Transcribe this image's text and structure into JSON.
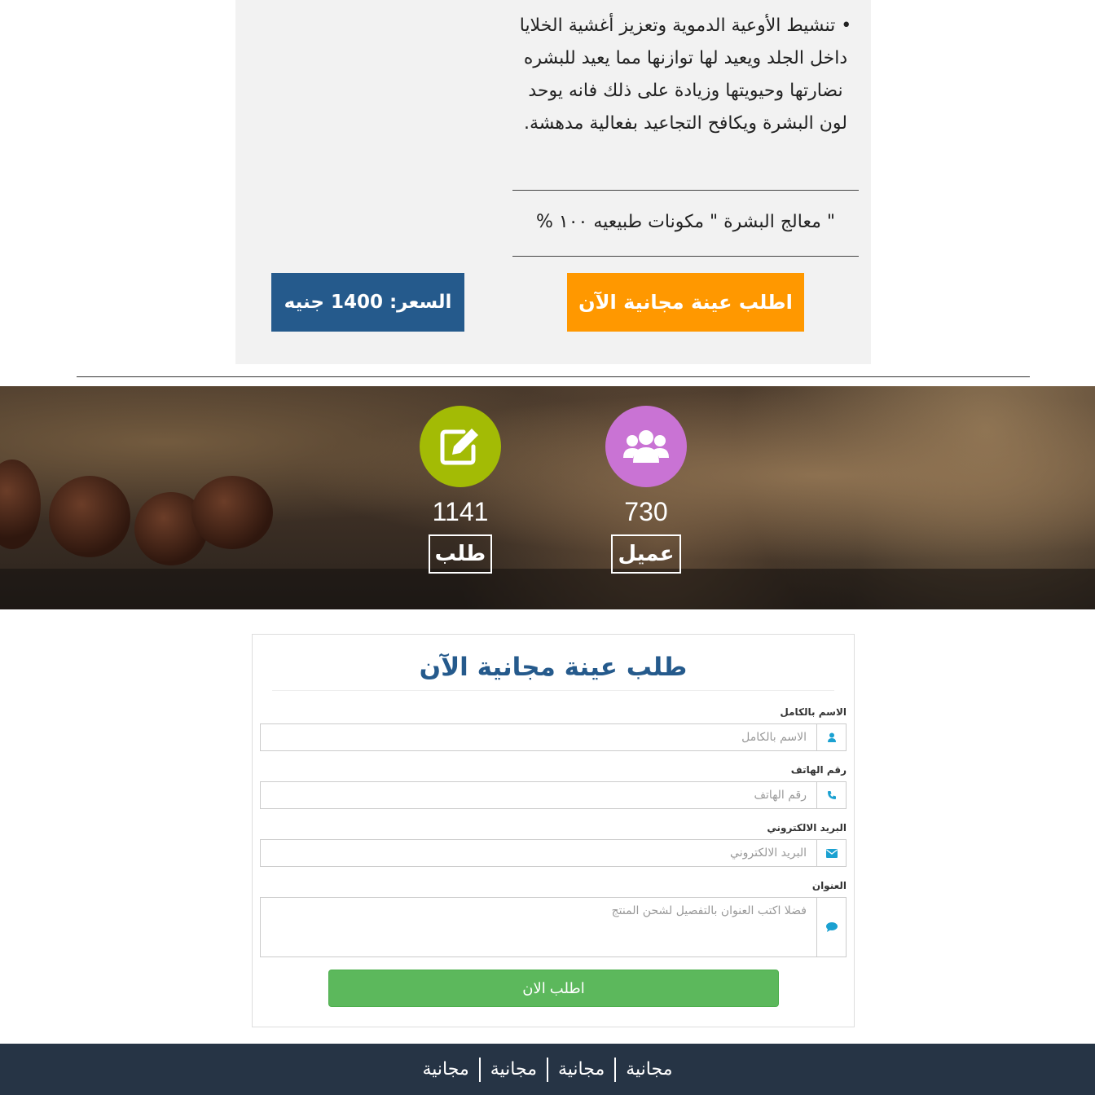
{
  "product": {
    "description": "• تنشيط الأوعية الدموية وتعزيز أغشية الخلايا داخل الجلد ويعيد لها توازنها مما يعيد للبشره نضارتها وحيويتها وزيادة على ذلك فانه يوحد لون البشرة ويكافح التجاعيد بفعالية مدهشة.",
    "tagline": "\" معالج البشرة \" مكونات طبيعيه ١٠٠ %",
    "cta_label": "اطلب عينة مجانية الآن",
    "price_label": "السعر: 1400 جنيه",
    "cta_color": "#ff9800",
    "price_color": "#255a8c"
  },
  "stats": [
    {
      "icon": "users-icon",
      "value": "730",
      "label": "عميل",
      "color": "#c973d4"
    },
    {
      "icon": "edit-icon",
      "value": "1141",
      "label": "طلب",
      "color": "#a3bb05"
    }
  ],
  "form": {
    "title": "طلب عينة مجانية الآن",
    "fields": [
      {
        "label": "الاسم بالكامل",
        "placeholder": "الاسم بالكامل",
        "icon": "user-icon"
      },
      {
        "label": "رقم الهاتف",
        "placeholder": "رقم الهاتف",
        "icon": "phone-icon"
      },
      {
        "label": "البريد الالكتروني",
        "placeholder": "البريد الالكتروني",
        "icon": "envelope-icon"
      },
      {
        "label": "العنوان",
        "placeholder": "فضلا اكتب العنوان بالتفصيل لشحن المنتج",
        "icon": "comment-icon"
      }
    ],
    "submit_label": "اطلب الان",
    "submit_color": "#5cb85c",
    "icon_color": "#1ba1d1"
  },
  "footer": {
    "items": [
      "مجانية",
      "مجانية",
      "مجانية",
      "مجانية"
    ],
    "background": "#263445"
  }
}
